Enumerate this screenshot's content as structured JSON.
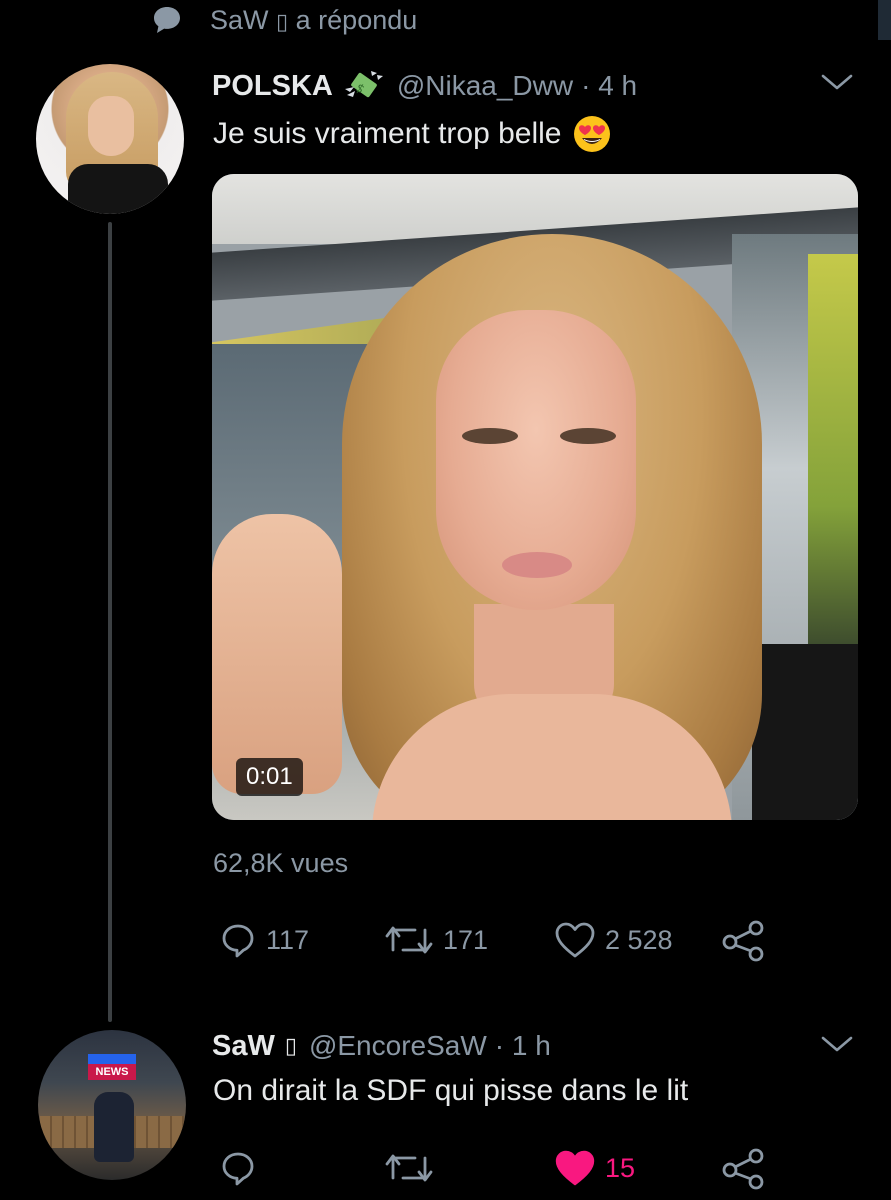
{
  "context": {
    "user": "SaW",
    "glyph": "▯",
    "action": "a répondu"
  },
  "tweet1": {
    "display_name": "POLSKA",
    "handle": "@Nikaa_Dww",
    "time": "· 4 h",
    "text": "Je suis vraiment trop belle",
    "video_time": "0:01",
    "views": "62,8K vues",
    "replies": "117",
    "retweets": "171",
    "likes": "2 528"
  },
  "tweet2": {
    "display_name": "SaW",
    "glyph": "▯",
    "handle": "@EncoreSaW",
    "time": "· 1 h",
    "text": "On dirait la SDF qui pisse dans le lit",
    "likes": "15",
    "liked": true
  },
  "avatar2_badge": "NEWS",
  "colors": {
    "background": "#000000",
    "text_primary": "#e7e9ea",
    "text_secondary": "#8b98a5",
    "like_active": "#f91880",
    "thread_line": "#3c4043"
  },
  "icons": {
    "context": "reply-bubble-icon",
    "money": "money-with-wings-icon",
    "emoji": "heart-eyes-emoji",
    "chevron": "chevron-down-icon",
    "reply": "reply-icon",
    "retweet": "retweet-icon",
    "like": "heart-icon",
    "share": "share-icon"
  }
}
